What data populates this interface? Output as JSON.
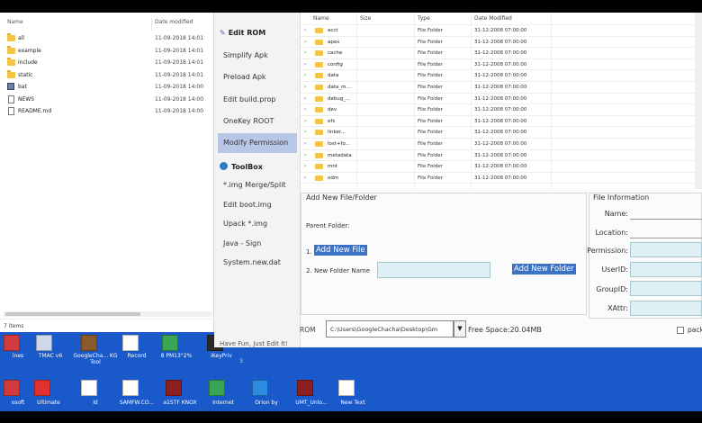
{
  "explorer": {
    "columns": {
      "name": "Name",
      "date": "Date modified"
    },
    "rows": [
      {
        "icon": "folder-icon",
        "name": "all",
        "date": "11-09-2018 14:01"
      },
      {
        "icon": "folder-icon",
        "name": "example",
        "date": "11-09-2018 14:01"
      },
      {
        "icon": "folder-icon",
        "name": "include",
        "date": "11-09-2018 14:01"
      },
      {
        "icon": "folder-icon",
        "name": "static",
        "date": "11-09-2018 14:01"
      },
      {
        "icon": "batch-file-icon",
        "name": "bat",
        "date": "11-09-2018 14:00"
      },
      {
        "icon": "file-icon",
        "name": "NEWS",
        "date": "11-09-2018 14:00"
      },
      {
        "icon": "file-icon",
        "name": "README.md",
        "date": "11-09-2018 14:00"
      }
    ],
    "status": "7 items"
  },
  "sidebar": {
    "edit_rom": "Edit ROM",
    "items": [
      "Simplify Apk",
      "Preload Apk",
      "Edit build.prop",
      "OneKey ROOT",
      "Modify Permission"
    ],
    "toolbox": "ToolBox",
    "tools": [
      "*.img Merge/Split",
      "Edit boot.img",
      "Upack  *.img",
      "Java - Sign",
      "System.new.dat"
    ],
    "footer": "Have Fun, Just Edit It!"
  },
  "folders": {
    "columns": {
      "name": "Name",
      "size": "Size",
      "type": "Type",
      "date": "Date Modified"
    },
    "rows": [
      {
        "name": "acct",
        "type": "File Folder",
        "date": "31-12-2008 07:00:00"
      },
      {
        "name": "apex",
        "type": "File Folder",
        "date": "31-12-2008 07:00:00"
      },
      {
        "name": "cache",
        "type": "File Folder",
        "date": "31-12-2008 07:00:00"
      },
      {
        "name": "config",
        "type": "File Folder",
        "date": "31-12-2008 07:00:00"
      },
      {
        "name": "data",
        "type": "File Folder",
        "date": "31-12-2008 07:00:00"
      },
      {
        "name": "data_m...",
        "type": "File Folder",
        "date": "31-12-2008 07:00:00"
      },
      {
        "name": "debug_...",
        "type": "File Folder",
        "date": "31-12-2008 07:00:00"
      },
      {
        "name": "dev",
        "type": "File Folder",
        "date": "31-12-2008 07:00:00"
      },
      {
        "name": "efs",
        "type": "File Folder",
        "date": "31-12-2008 07:00:00"
      },
      {
        "name": "linker...",
        "type": "File Folder",
        "date": "31-12-2008 07:00:00"
      },
      {
        "name": "lost+fo...",
        "type": "File Folder",
        "date": "31-12-2008 07:00:00"
      },
      {
        "name": "metadata",
        "type": "File Folder",
        "date": "31-12-2008 07:00:00"
      },
      {
        "name": "mnt",
        "type": "File Folder",
        "date": "31-12-2008 07:00:00"
      },
      {
        "name": "odm",
        "type": "File Folder",
        "date": "31-12-2008 07:00:00"
      }
    ]
  },
  "add_new": {
    "title": "Add New File/Folder",
    "parent_folder": "Parent Folder:",
    "row1_num": "1.",
    "add_file": "Add New File",
    "row2_num": "2.",
    "folder_name": "New Folder Name",
    "add_folder": "Add New Folder"
  },
  "file_info": {
    "title": "File Information",
    "name": "Name:",
    "location": "Location:",
    "permission": "Permission:",
    "userid": "UserID:",
    "groupid": "GroupID:",
    "xattr": "XAttr:"
  },
  "rom_bar": {
    "label": "ROM",
    "path": "C:\\Users\\GoogleChacha\\Desktop\\Gm",
    "free_space": "Free Space:20.04MB",
    "pack": "pack"
  },
  "desktop": {
    "row1": [
      {
        "label": "ines",
        "color": "#d23b3b"
      },
      {
        "label": "TMAC v6",
        "color": "#cfd8e8"
      },
      {
        "label": "GoogleCha... KG Tool",
        "color": "#8b5a2b"
      },
      {
        "label": "Record",
        "color": "#ffffff"
      },
      {
        "label": "8 PM13°2%",
        "color": "#3aa655"
      },
      {
        "label": "iKeyPriv",
        "color": "#2a2a2a"
      }
    ],
    "row2": [
      {
        "label": "osoft",
        "color": "#d23b3b"
      },
      {
        "label": "Ultimate",
        "color": "#e03030"
      },
      {
        "label": "ld",
        "color": "#ffffff"
      },
      {
        "label": "SAMFW.CO...",
        "color": "#ffffff"
      },
      {
        "label": "a1STF KNOX",
        "color": "#8b1e1e"
      },
      {
        "label": "Internet",
        "color": "#3aa655"
      },
      {
        "label": "Orion by",
        "color": "#2a8be0"
      },
      {
        "label": "UMT_Unlo...",
        "color": "#8b1e1e"
      },
      {
        "label": "New Text",
        "color": "#ffffff"
      }
    ],
    "faded": [
      "3"
    ]
  },
  "colors": {
    "desktop_blue": "#1a59c9",
    "selection": "#3b72c6",
    "active_item": "#b9c7e6",
    "input_bg": "#dff0f4"
  }
}
